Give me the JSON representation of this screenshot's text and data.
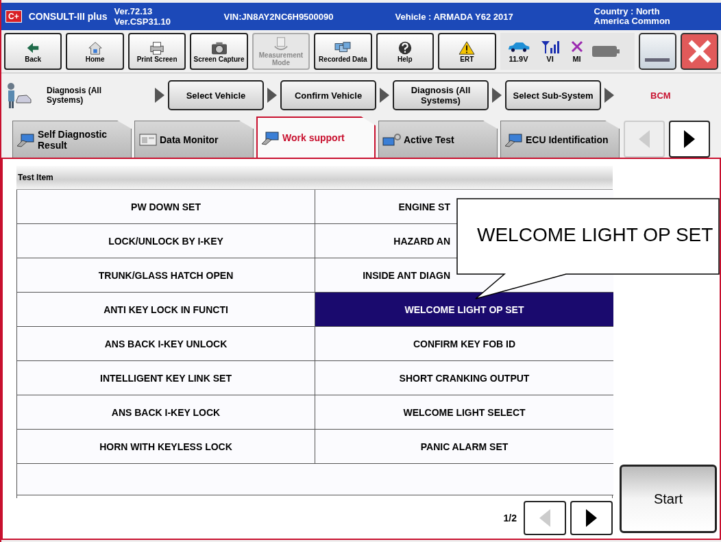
{
  "header": {
    "logo": "C+",
    "app_name": "CONSULT-III plus",
    "versions": [
      "Ver.72.13",
      "Ver.CSP31.10"
    ],
    "vin": "VIN:JN8AY2NC6H9500090",
    "vehicle": "Vehicle : ARMADA Y62 2017",
    "country": "Country : North America Common"
  },
  "toolbar": [
    {
      "label": "Back",
      "disabled": false
    },
    {
      "label": "Home",
      "disabled": false
    },
    {
      "label": "Print Screen",
      "disabled": false
    },
    {
      "label": "Screen Capture",
      "disabled": false
    },
    {
      "label": "Measurement Mode",
      "disabled": true
    },
    {
      "label": "Recorded Data",
      "disabled": false
    },
    {
      "label": "Help",
      "disabled": false
    },
    {
      "label": "ERT",
      "disabled": false
    }
  ],
  "status": {
    "voltage": "11.9V",
    "vi": "VI",
    "mi": "MI"
  },
  "breadcrumb": {
    "current": "Diagnosis (All Systems)",
    "steps": [
      "Select Vehicle",
      "Confirm Vehicle",
      "Diagnosis (All Systems)",
      "Select Sub-System"
    ],
    "system": "BCM"
  },
  "tabs": [
    {
      "label": "Self Diagnostic Result",
      "selected": false
    },
    {
      "label": "Data Monitor",
      "selected": false
    },
    {
      "label": "Work support",
      "selected": true
    },
    {
      "label": "Active Test",
      "selected": false
    },
    {
      "label": "ECU Identification",
      "selected": false
    }
  ],
  "table": {
    "header": "Test Item",
    "rows": [
      [
        {
          "text": "PW DOWN SET",
          "selected": false,
          "kind": "full"
        },
        {
          "text": "ENGINE ST",
          "selected": false,
          "kind": "covered"
        }
      ],
      [
        {
          "text": "LOCK/UNLOCK BY I-KEY",
          "selected": false,
          "kind": "full"
        },
        {
          "text": "HAZARD AN",
          "selected": false,
          "kind": "covered"
        }
      ],
      [
        {
          "text": "TRUNK/GLASS HATCH OPEN",
          "selected": false,
          "kind": "full"
        },
        {
          "text": "INSIDE ANT DIAGN",
          "selected": false,
          "kind": "covered"
        }
      ],
      [
        {
          "text": "ANTI KEY LOCK IN FUNCTI",
          "selected": false,
          "kind": "full"
        },
        {
          "text": "WELCOME LIGHT OP SET",
          "selected": true,
          "kind": "full"
        }
      ],
      [
        {
          "text": "ANS BACK I-KEY UNLOCK",
          "selected": false,
          "kind": "full"
        },
        {
          "text": "CONFIRM KEY FOB ID",
          "selected": false,
          "kind": "full"
        }
      ],
      [
        {
          "text": "INTELLIGENT KEY LINK SET",
          "selected": false,
          "kind": "full"
        },
        {
          "text": "SHORT CRANKING OUTPUT",
          "selected": false,
          "kind": "full"
        }
      ],
      [
        {
          "text": "ANS BACK I-KEY LOCK",
          "selected": false,
          "kind": "full"
        },
        {
          "text": "WELCOME LIGHT  SELECT",
          "selected": false,
          "kind": "full"
        }
      ],
      [
        {
          "text": "HORN WITH KEYLESS LOCK",
          "selected": false,
          "kind": "full"
        },
        {
          "text": "PANIC ALARM SET",
          "selected": false,
          "kind": "full"
        }
      ]
    ],
    "page": "1/2"
  },
  "start_button": "Start",
  "callout": "WELCOME LIGHT OP SET"
}
